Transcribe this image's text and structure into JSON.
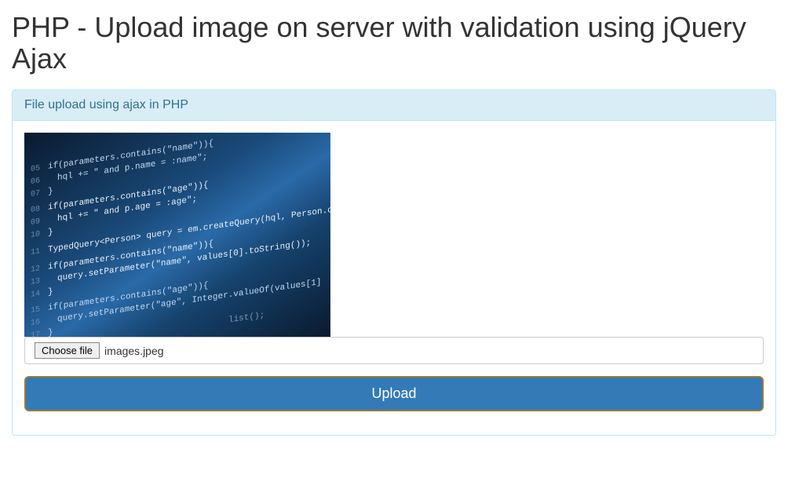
{
  "page": {
    "title": "PHP - Upload image on server with validation using jQuery Ajax"
  },
  "panel": {
    "heading": "File upload using ajax in PHP"
  },
  "upload": {
    "choose_file_label": "Choose file",
    "selected_filename": "images.jpeg",
    "submit_label": "Upload"
  }
}
